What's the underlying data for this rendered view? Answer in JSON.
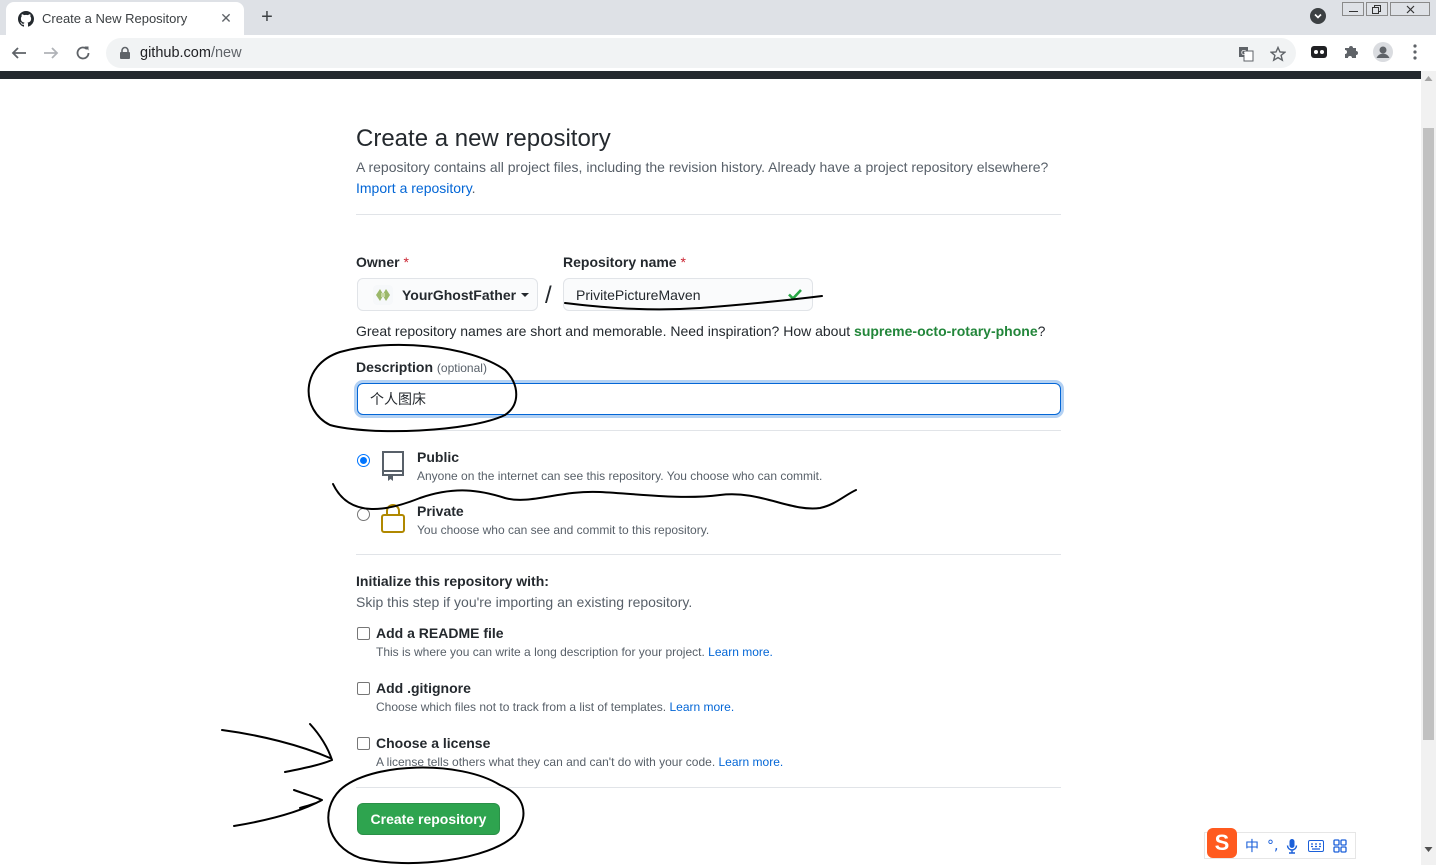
{
  "browser": {
    "tab_title": "Create a New Repository",
    "url_host": "github.com",
    "url_path": "/new"
  },
  "page": {
    "title": "Create a new repository",
    "subtitle": "A repository contains all project files, including the revision history. Already have a project repository elsewhere?",
    "import_link": "Import a repository",
    "import_tail": "."
  },
  "form": {
    "owner_label": "Owner",
    "required_mark": "*",
    "owner_value": "YourGhostFather",
    "slash": "/",
    "repo_label": "Repository name",
    "repo_value": "PrivitePictureMaven",
    "hint_prefix": "Great repository names are short and memorable. Need inspiration? How about",
    "hint_suggestion": "supreme-octo-rotary-phone",
    "hint_suffix": "?",
    "description_label": "Description",
    "description_optional": "(optional)",
    "description_value": "个人图床"
  },
  "visibility": {
    "public_title": "Public",
    "public_desc": "Anyone on the internet can see this repository. You choose who can commit.",
    "private_title": "Private",
    "private_desc": "You choose who can see and commit to this repository.",
    "selected": "public"
  },
  "init": {
    "title": "Initialize this repository with:",
    "subtitle": "Skip this step if you're importing an existing repository.",
    "readme_label": "Add a README file",
    "readme_desc": "This is where you can write a long description for your project.",
    "gitignore_label": "Add .gitignore",
    "gitignore_desc": "Choose which files not to track from a list of templates.",
    "license_label": "Choose a license",
    "license_desc": "A license tells others what they can and can't do with your code.",
    "learn_more": "Learn more."
  },
  "submit_label": "Create repository",
  "ime": {
    "logo": "S",
    "mode": "中",
    "punct": "°,"
  },
  "colors": {
    "primary_button": "#2ea44f",
    "link": "#0366d6",
    "suggestion": "#22863a",
    "dark_header": "#24292e"
  }
}
